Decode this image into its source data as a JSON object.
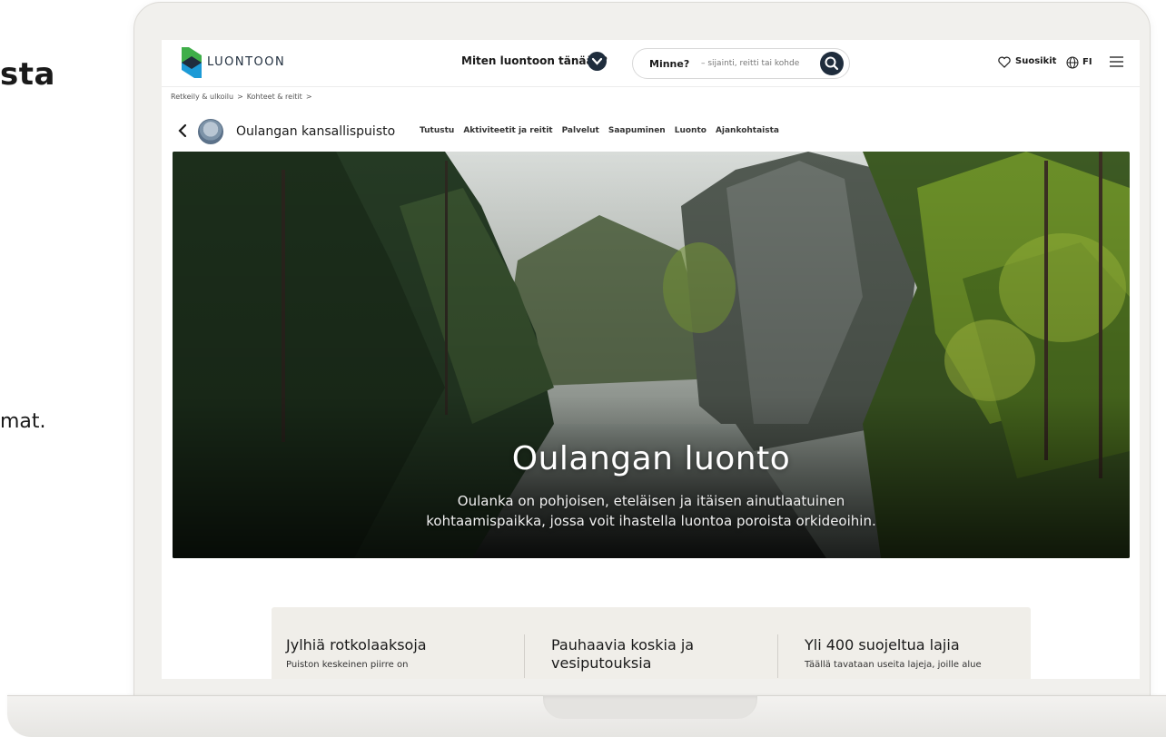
{
  "slide": {
    "title_fragment": "sta",
    "text_fragment": "mat."
  },
  "header": {
    "logo_text": "LUONTOON",
    "mood_link": "Miten luontoon tänään?",
    "search_label": "Minne?",
    "search_placeholder": "– sijainti, reitti tai kohde",
    "favorites_label": "Suosikit",
    "language": "FI"
  },
  "breadcrumb": [
    "Retkeily & ulkoilu",
    "Kohteet & reitit"
  ],
  "park": {
    "name": "Oulangan kansallispuisto",
    "tabs": [
      "Tutustu",
      "Aktiviteetit ja reitit",
      "Palvelut",
      "Saapuminen",
      "Luonto",
      "Ajankohtaista"
    ]
  },
  "hero": {
    "title": "Oulangan luonto",
    "subtitle_line1": "Oulanka on pohjoisen, eteläisen ja itäisen ainutlaatuinen",
    "subtitle_line2": "kohtaamispaikka, jossa voit ihastella luontoa poroista orkideoihin."
  },
  "facts": [
    {
      "title": "Jylhiä rotkolaaksoja",
      "body": "Puiston keskeinen piirre on"
    },
    {
      "title_line1": "Pauhaavia koskia ja",
      "title_line2": "vesiputouksia"
    },
    {
      "title": "Yli 400 suojeltua lajia",
      "body": "Täällä tavataan useita lajeja, joille alue"
    }
  ],
  "colors": {
    "brand_navy": "#1f2d3d",
    "logo_green": "#3fae49",
    "logo_blue": "#1c9ad6",
    "facts_background": "#f0eee9"
  }
}
